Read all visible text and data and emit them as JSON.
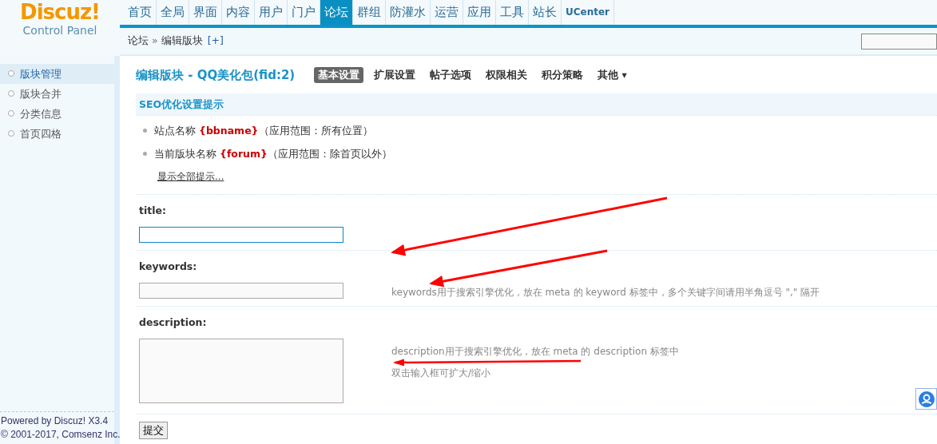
{
  "logo": {
    "brand": "Discuz!",
    "subtitle": "Control Panel"
  },
  "nav": [
    {
      "label": "首页",
      "selected": false
    },
    {
      "label": "全局",
      "selected": false
    },
    {
      "label": "界面",
      "selected": false
    },
    {
      "label": "内容",
      "selected": false
    },
    {
      "label": "用户",
      "selected": false
    },
    {
      "label": "门户",
      "selected": false
    },
    {
      "label": "论坛",
      "selected": true
    },
    {
      "label": "群组",
      "selected": false
    },
    {
      "label": "防灌水",
      "selected": false
    },
    {
      "label": "运营",
      "selected": false
    },
    {
      "label": "应用",
      "selected": false
    },
    {
      "label": "工具",
      "selected": false
    },
    {
      "label": "站长",
      "selected": false
    },
    {
      "label": "UCenter",
      "selected": false
    }
  ],
  "breadcrumb": {
    "items": [
      "论坛",
      "编辑版块"
    ],
    "separator": "»",
    "add": "[+]"
  },
  "sidebar": {
    "items": [
      {
        "label": "版块管理",
        "selected": true
      },
      {
        "label": "版块合并",
        "selected": false
      },
      {
        "label": "分类信息",
        "selected": false
      },
      {
        "label": "首页四格",
        "selected": false
      }
    ],
    "footer": [
      "Powered by Discuz! X3.4",
      "© 2001-2017, Comsenz Inc."
    ]
  },
  "page_title": "编辑版块 - QQ美化包(fid:2)",
  "tabs": [
    {
      "label": "基本设置",
      "selected": true
    },
    {
      "label": "扩展设置",
      "selected": false
    },
    {
      "label": "帖子选项",
      "selected": false
    },
    {
      "label": "权限相关",
      "selected": false
    },
    {
      "label": "积分策略",
      "selected": false
    },
    {
      "label": "其他 ▾",
      "selected": false
    }
  ],
  "seo_tips": {
    "heading": "SEO优化设置提示",
    "items": [
      "站点名称 **{bbname}**（应用范围：所有位置）",
      "当前版块名称 **{forum}**（应用范围：除首页以外）"
    ],
    "link": "显示全部提示..."
  },
  "fields": [
    {
      "label": "title:",
      "kind": "input",
      "focused": true
    },
    {
      "label": "keywords:",
      "kind": "input",
      "focused": false,
      "hint": [
        "keywords用于搜索引擎优化，放在 meta 的 keyword 标签中，多个关键字间请用半角逗号 \",\" 隔开"
      ]
    },
    {
      "label": "description:",
      "kind": "textarea",
      "focused": false,
      "hint": [
        "description用于搜索引擎优化，放在 meta 的 description 标签中",
        "双击输入框可扩大/缩小"
      ]
    }
  ],
  "submit": "提交"
}
